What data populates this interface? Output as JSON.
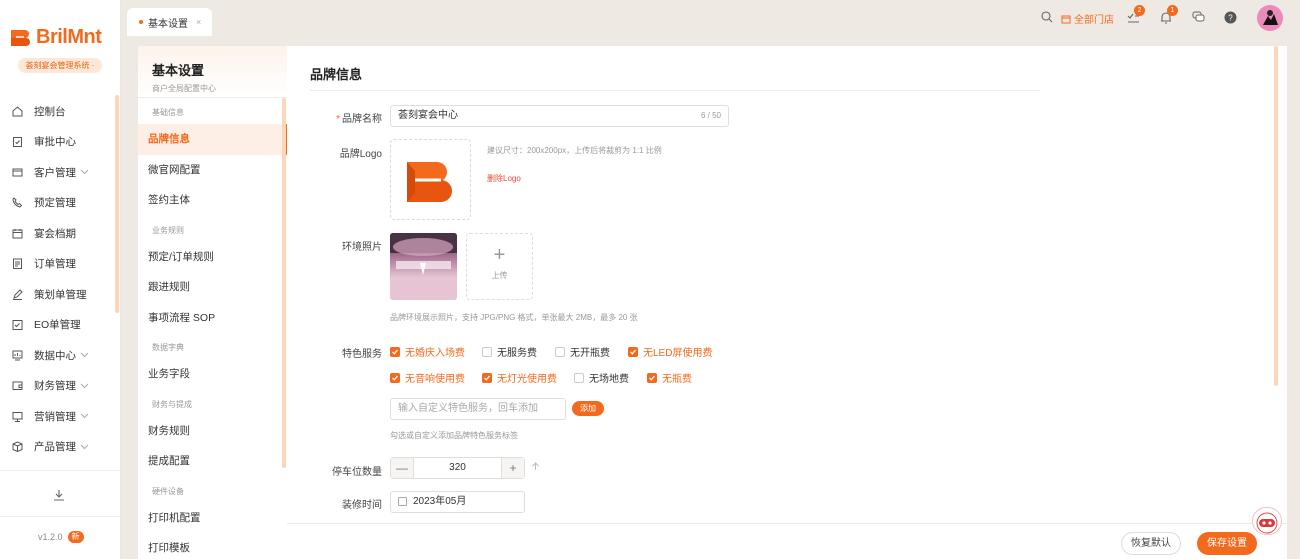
{
  "brand": {
    "name": "BrilMnt",
    "system": "荟刻宴会管理系统 ·"
  },
  "nav": [
    {
      "label": "控制台",
      "icon": "home-icon"
    },
    {
      "label": "审批中心",
      "icon": "clipboard-check-icon"
    },
    {
      "label": "客户管理",
      "icon": "customer-icon",
      "expand": true
    },
    {
      "label": "预定管理",
      "icon": "phone-icon"
    },
    {
      "label": "宴会档期",
      "icon": "calendar-icon"
    },
    {
      "label": "订单管理",
      "icon": "order-icon"
    },
    {
      "label": "策划单管理",
      "icon": "pen-icon"
    },
    {
      "label": "EO单管理",
      "icon": "eo-icon"
    },
    {
      "label": "数据中心",
      "icon": "chart-icon",
      "expand": true
    },
    {
      "label": "财务管理",
      "icon": "wallet-icon",
      "expand": true
    },
    {
      "label": "营销管理",
      "icon": "monitor-icon",
      "expand": true
    },
    {
      "label": "产品管理",
      "icon": "box-icon",
      "expand": true
    }
  ],
  "version": {
    "label": "v1.2.0",
    "badge": "新"
  },
  "tab": {
    "label": "基本设置",
    "close": "×"
  },
  "topbar": {
    "store": "全部门店",
    "todo_badge": "2",
    "bell_badge": "1"
  },
  "panel": {
    "title": "基本设置",
    "subtitle": "商户全局配置中心",
    "groups": [
      {
        "name": "基础信息",
        "items": [
          "品牌信息",
          "微官网配置",
          "签约主体"
        ]
      },
      {
        "name": "业务规则",
        "items": [
          "预定/订单规则",
          "跟进规则",
          "事项流程 SOP"
        ]
      },
      {
        "name": "数据字典",
        "items": [
          "业务字段"
        ]
      },
      {
        "name": "财务与提成",
        "items": [
          "财务规则",
          "提成配置"
        ]
      },
      {
        "name": "硬件设备",
        "items": [
          "打印机配置",
          "打印模板"
        ]
      }
    ]
  },
  "form": {
    "title": "品牌信息",
    "brand_name": {
      "label": "品牌名称",
      "required": "*",
      "value": "荟刻宴会中心",
      "count": "6 / 50"
    },
    "logo": {
      "label": "品牌Logo",
      "hint": "建议尺寸：200x200px，上传后将裁剪为 1:1 比例",
      "delete": "删除Logo"
    },
    "photos": {
      "label": "环境照片",
      "upload": "上传",
      "hint": "品牌环境展示照片，支持 JPG/PNG 格式，单张最大 2MB，最多 20 张"
    },
    "features": {
      "label": "特色服务",
      "options": [
        {
          "label": "无婚庆入场费",
          "checked": true
        },
        {
          "label": "无服务费",
          "checked": false
        },
        {
          "label": "无开瓶费",
          "checked": false
        },
        {
          "label": "无LED屏使用费",
          "checked": true
        },
        {
          "label": "无音响使用费",
          "checked": true
        },
        {
          "label": "无灯光使用费",
          "checked": true
        },
        {
          "label": "无场地费",
          "checked": false
        },
        {
          "label": "无瓶费",
          "checked": true
        }
      ],
      "custom_placeholder": "输入自定义特色服务，回车添加",
      "add": "添加",
      "hint": "勾选或自定义添加品牌特色服务标签"
    },
    "parking": {
      "label": "停车位数量",
      "value": "320",
      "minus": "—",
      "plus": "+"
    },
    "renovation": {
      "label": "装修时间",
      "value": "2023年05月"
    }
  },
  "footer": {
    "reset": "恢复默认",
    "save": "保存设置"
  },
  "colors": {
    "accent": "#f36a1d",
    "bg": "#efe9e4"
  }
}
